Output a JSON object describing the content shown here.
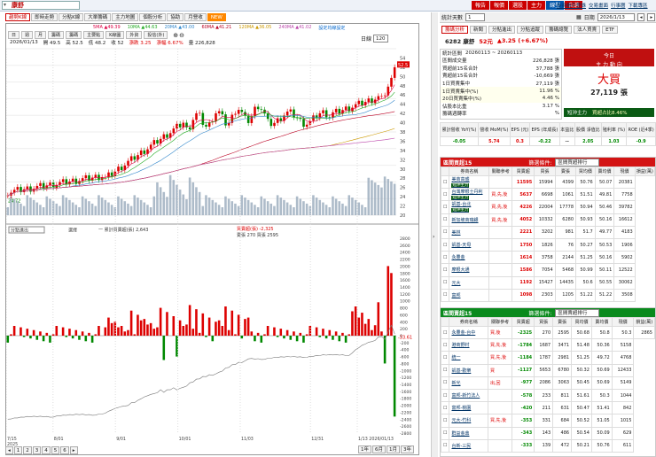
{
  "top": {
    "symbol": "康舒",
    "buttons": [
      "報告",
      "報價",
      "選股",
      "主力",
      "線型",
      "自選"
    ],
    "colors": [
      "#cc0000",
      "#cc0000",
      "#cc0000",
      "#cc0000",
      "#0055aa",
      "#cc0000"
    ],
    "links": [
      "券商帳戶登錄",
      "交易畫面",
      "行事曆",
      "下載專區"
    ]
  },
  "tabs": [
    "趨勢K線",
    "即時走勢",
    "分點K線",
    "大單籌碼",
    "主力地圖",
    "個股分析",
    "協助",
    "月營收"
  ],
  "tabs_new": "NEW",
  "ma": [
    {
      "label": "5MA",
      "value": "49.39",
      "color": "#d04"
    },
    {
      "label": "10MA",
      "value": "44.63",
      "color": "#2a2"
    },
    {
      "label": "20MA",
      "value": "43.00",
      "color": "#38c"
    },
    {
      "label": "60MA",
      "value": "41.21",
      "color": "#b02"
    },
    {
      "label": "120MA",
      "value": "36.05",
      "color": "#c90"
    },
    {
      "label": "240MA",
      "value": "41.02",
      "color": "#b4a"
    }
  ],
  "ma_link": "設定均線設定",
  "sub_tabs": [
    "日",
    "週",
    "月",
    "籌碼",
    "籌碼",
    "主要點",
    "K線圖",
    "外資",
    "投信(外)"
  ],
  "range_label": "日線",
  "range_value": "120",
  "ohlc": {
    "date": "2026/01/13",
    "open_label": "開",
    "open": "49.5",
    "high_label": "高",
    "high": "52.5",
    "low_label": "低",
    "low": "48.2",
    "close_label": "收",
    "close": "52",
    "change": "漲跌 3.25",
    "pct": "漲幅 6.67%",
    "vol_label": "量",
    "vol": "226,828"
  },
  "price_ticks": [
    "54",
    "52",
    "50",
    "48",
    "46",
    "44",
    "42",
    "40",
    "38",
    "36",
    "34",
    "32",
    "30",
    "28",
    "26",
    "24",
    "22",
    "20"
  ],
  "last_price_tag": "52.5",
  "low_tag": "24.72",
  "sub_panel": {
    "dropdown": "分點進出",
    "label": "選擇",
    "legend1": "一 累計買賣超(張) 2,643",
    "legend2": "買賣超(張) -2,325",
    "legend3": "賣張 270 買張 2595",
    "last_tag": "-33.61"
  },
  "sub_ticks": [
    "2800",
    "2600",
    "2400",
    "2200",
    "2000",
    "1800",
    "1600",
    "1400",
    "1200",
    "1000",
    "800",
    "600",
    "400",
    "200",
    "0",
    "-200",
    "-400",
    "-600",
    "-800",
    "-1000",
    "-1200",
    "-1400",
    "-1600",
    "-1800",
    "-2000",
    "-2200",
    "-2400",
    "-2600",
    "-2800"
  ],
  "x_ticks": [
    "7/15\n2025",
    "8/01",
    "9/01",
    "10/01",
    "11/03",
    "12/31",
    "1/13 2026/01/13"
  ],
  "bottom": {
    "pages": [
      "1",
      "2",
      "3",
      "4",
      "5",
      "6"
    ],
    "btns": [
      "1年",
      "6月",
      "1月",
      "3年"
    ]
  },
  "right": {
    "topbar_label": "統計天數",
    "topbar_value": "1",
    "date_label": "日期",
    "date": "2026/1/13",
    "rtabs": [
      "籌碼分析",
      "新聞",
      "分點進出",
      "分點追蹤",
      "籌碼總覽",
      "法人買賣",
      "ETF"
    ],
    "stock": "6282 康舒",
    "price": "52元",
    "chg": "▲3.25 (+6.67%)",
    "period_label": "統計區間",
    "period": "20260113 ~ 20260113",
    "today": "今日",
    "today_sub": "主 力 動 向",
    "big": "大買",
    "big_qty": "27,119 張",
    "info": [
      [
        "區間成交量",
        "226,828 張"
      ],
      [
        "買超前15名合計",
        "37,788 張"
      ],
      [
        "賣超前15名合計",
        "-10,669 張"
      ],
      [
        "1日買賣集中",
        "27,119 張"
      ],
      [
        "1日買賣集中(%)",
        "11.96 %"
      ],
      [
        "20日買賣集中(%)",
        "4.46 %"
      ],
      [
        "佔股本比重",
        "3.17 %"
      ],
      [
        "籌碼週轉率",
        "%"
      ]
    ],
    "short": "短沖主力",
    "short_val": "買超占比8.46%",
    "fin_heads": [
      "累計營收 YoY(%)",
      "營收 MoM(%)",
      "EPS (元)",
      "EPS (年成長)",
      "本益比",
      "股價 淨值比",
      "殖利率 (%)",
      "ROE (近4季)"
    ],
    "fin_vals": [
      "-0.05",
      "5.74",
      "0.3",
      "-0.22",
      "--",
      "2.05",
      "1.03",
      "-0.9"
    ],
    "fin_colors": [
      "#080",
      "#d00",
      "#d00",
      "#080",
      "#333",
      "#080",
      "#080",
      "#080"
    ],
    "buy_title": "區間買超15",
    "buy_sel_label": "篩選條件:",
    "buy_sel": "區間買超排行",
    "cols": [
      "券商名稱",
      "關聯參考",
      "買賣超",
      "買張",
      "賣張",
      "買均價",
      "賣均價",
      "現價",
      "損益(萬)"
    ],
    "buy_rows": [
      [
        "美商高盛",
        "",
        "11595",
        "15994",
        "4399",
        "50.76",
        "50.07",
        "20381"
      ],
      [
        "台灣摩根士丹利",
        "買,先,後",
        "5637",
        "6698",
        "1061",
        "51.51",
        "49.81",
        "7758"
      ],
      [
        "凱基-台北",
        "買,先,後",
        "4226",
        "22004",
        "17778",
        "50.94",
        "50.46",
        "39782"
      ],
      [
        "新加坡商瑞銀",
        "買,先,後",
        "4052",
        "10332",
        "6280",
        "50.93",
        "50.16",
        "16612"
      ],
      [
        "美林",
        "",
        "2221",
        "3202",
        "981",
        "51.7",
        "49.77",
        "4183"
      ],
      [
        "凱基-天母",
        "",
        "1750",
        "1826",
        "76",
        "50.27",
        "50.53",
        "1906"
      ],
      [
        "永豐金",
        "",
        "1614",
        "3758",
        "2144",
        "51.25",
        "50.16",
        "5902"
      ],
      [
        "摩根大通",
        "",
        "1586",
        "7054",
        "5468",
        "50.99",
        "50.11",
        "12522"
      ],
      [
        "元大",
        "",
        "1192",
        "15427",
        "14435",
        "50.6",
        "50.55",
        "30062"
      ],
      [
        "富邦",
        "",
        "1098",
        "2303",
        "1205",
        "51.22",
        "51.22",
        "3508"
      ]
    ],
    "tags": [
      "短沖主力",
      "短沖主力",
      "短沖主力"
    ],
    "sell_title": "區間賣超15",
    "sell_sel_label": "篩選條件:",
    "sell_sel": "區間賣超排行",
    "sell_rows": [
      [
        "永豐金-台中",
        "買,後",
        "-2325",
        "270",
        "2595",
        "50.68",
        "50.8",
        "50.3",
        "2865"
      ],
      [
        "港商野村",
        "買,先,後",
        "-1784",
        "1687",
        "3471",
        "51.48",
        "50.36",
        "5158"
      ],
      [
        "統一",
        "買,先,後",
        "-1184",
        "1787",
        "2981",
        "51.25",
        "49.72",
        "4768"
      ],
      [
        "凱基-歡樂",
        "買",
        "-1127",
        "5653",
        "6780",
        "50.32",
        "50.69",
        "12433"
      ],
      [
        "新光",
        "出,回",
        "-977",
        "2086",
        "3063",
        "50.45",
        "50.69",
        "5149"
      ],
      [
        "富邦-新竹法人",
        "",
        "-578",
        "233",
        "811",
        "51.61",
        "50.3",
        "1044"
      ],
      [
        "富邦-桃園",
        "",
        "-420",
        "211",
        "631",
        "50.47",
        "51.41",
        "842"
      ],
      [
        "元大-竹科",
        "買,先,後",
        "-353",
        "331",
        "684",
        "50.52",
        "51.05",
        "1015"
      ],
      [
        "群益金鼎",
        "",
        "-343",
        "143",
        "486",
        "50.54",
        "50.09",
        "629"
      ],
      [
        "台新-三民",
        "",
        "-333",
        "139",
        "472",
        "50.21",
        "50.76",
        "611"
      ]
    ]
  }
}
